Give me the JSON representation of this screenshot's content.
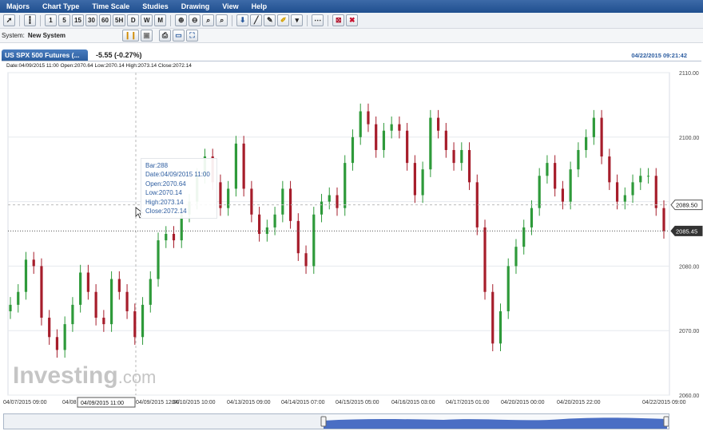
{
  "menu": [
    "Majors",
    "Chart Type",
    "Time Scale",
    "Studies",
    "Drawing",
    "View",
    "Help"
  ],
  "toolbar": {
    "intervals": [
      "1",
      "5",
      "15",
      "30",
      "60",
      "5H",
      "D",
      "W",
      "M"
    ]
  },
  "system": {
    "label": "System:",
    "name": "New System"
  },
  "tab": {
    "symbol": "US SPX 500 Futures (...",
    "change": "-5.55 (-0.27%)",
    "datetime": "04/22/2015 09:21:42"
  },
  "ohlc_line": "Date:04/09/2015 11:00 Open:2070.64 Low:2070.14 High:2073.14 Close:2072.14",
  "tooltip": {
    "bar": "Bar:288",
    "date": "Date:04/09/2015 11:00",
    "open": "Open:2070.64",
    "low": "Low:2070.14",
    "high": "High:2073.14",
    "close": "Close:2072.14"
  },
  "watermark": {
    "main": "Investing",
    "suffix": ".com"
  },
  "colors": {
    "up": "#2e9a3a",
    "down": "#a61d2b",
    "accent": "#2d5da0",
    "menu": "#2a5a99"
  },
  "chart_data": {
    "type": "candlestick",
    "y_ticks": [
      "2110.00",
      "2100.00",
      "2090.00",
      "2080.00",
      "2070.00",
      "2060.00"
    ],
    "ylim": [
      2060,
      2110
    ],
    "x_ticks": [
      "04/07/2015 09:00",
      "04/08",
      "04/09/2015 11:00",
      "04/09/2015 12:00",
      "04/10/2015 10:00",
      "04/13/2015 09:00",
      "04/14/2015 07:00",
      "04/15/2015 05:00",
      "04/16/2015 03:00",
      "04/17/2015 01:00",
      "04/20/2015 00:00",
      "04/20/2015 22:00",
      "04/22/2015 09:00"
    ],
    "crosshair_date": "04/09/2015 11:00",
    "price_labels": [
      "2089.50",
      "2085.45"
    ],
    "last_price": 2085.45,
    "hover_price": 2089.5,
    "series": {
      "price": [
        2074,
        2076,
        2081,
        2080,
        2072,
        2069,
        2067,
        2071,
        2074,
        2079,
        2076,
        2072,
        2071,
        2078,
        2076,
        2073,
        2069,
        2074,
        2078,
        2084,
        2085,
        2084,
        2088,
        2090,
        2094,
        2097,
        2093,
        2089,
        2092,
        2099,
        2092,
        2088,
        2085,
        2086,
        2088,
        2092,
        2087,
        2082,
        2080,
        2088,
        2090,
        2091,
        2089,
        2096,
        2100,
        2104,
        2102,
        2098,
        2101,
        2102,
        2101,
        2096,
        2091,
        2095,
        2103,
        2101,
        2098,
        2096,
        2098,
        2093,
        2086,
        2076,
        2068,
        2073,
        2080,
        2083,
        2086,
        2089,
        2094,
        2096,
        2092,
        2090,
        2095,
        2098,
        2100,
        2103,
        2097,
        2093,
        2090,
        2091,
        2093,
        2094,
        2094,
        2089,
        2085.45
      ]
    }
  }
}
